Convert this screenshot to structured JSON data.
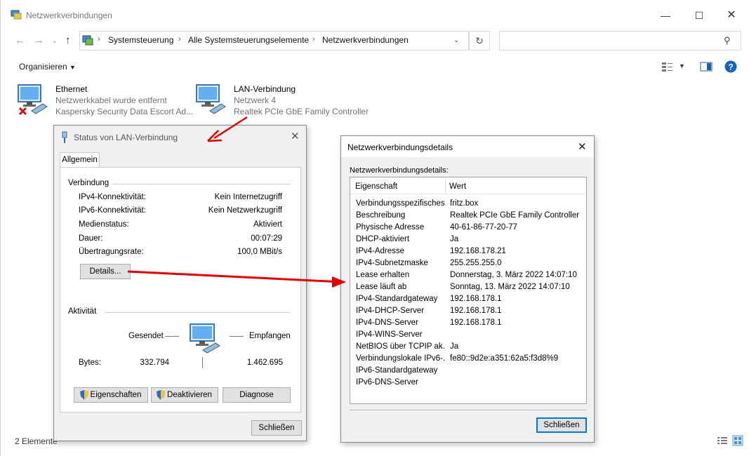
{
  "explorer": {
    "title": "Netzwerkverbindungen",
    "breadcrumb": [
      "Systemsteuerung",
      "Alle Systemsteuerungselemente",
      "Netzwerkverbindungen"
    ],
    "search_placeholder": "",
    "toolbar": {
      "organize_label": "Organisieren"
    },
    "items": [
      {
        "name": "Ethernet",
        "line1": "Netzwerkkabel wurde entfernt",
        "line2": "Kaspersky Security Data Escort Ad...",
        "status": "disconnected"
      },
      {
        "name": "LAN-Verbindung",
        "line1": "Netzwerk 4",
        "line2": "Realtek PCIe GbE Family Controller",
        "status": "connected"
      }
    ],
    "status_text": "2 Elemente"
  },
  "status_dialog": {
    "title": "Status von LAN-Verbindung",
    "tab": "Allgemein",
    "connection_group": "Verbindung",
    "rows": [
      {
        "label": "IPv4-Konnektivität:",
        "value": "Kein Internetzugriff"
      },
      {
        "label": "IPv6-Konnektivität:",
        "value": "Kein Netzwerkzugriff"
      },
      {
        "label": "Medienstatus:",
        "value": "Aktiviert"
      },
      {
        "label": "Dauer:",
        "value": "00:07:29"
      },
      {
        "label": "Übertragungsrate:",
        "value": "100,0 MBit/s"
      }
    ],
    "details_button": "Details...",
    "activity_group": "Aktivität",
    "sent_label": "Gesendet",
    "received_label": "Empfangen",
    "bytes_label": "Bytes:",
    "bytes_sent": "332.794",
    "bytes_received": "1.462.695",
    "properties_button": "Eigenschaften",
    "disable_button": "Deaktivieren",
    "diagnose_button": "Diagnose",
    "close_button": "Schließen"
  },
  "details_dialog": {
    "title": "Netzwerkverbindungsdetails",
    "label": "Netzwerkverbindungsdetails:",
    "col_property": "Eigenschaft",
    "col_value": "Wert",
    "rows": [
      {
        "k": "Verbindungsspezifisches...",
        "v": "fritz.box"
      },
      {
        "k": "Beschreibung",
        "v": "Realtek PCIe GbE Family Controller"
      },
      {
        "k": "Physische Adresse",
        "v": "40-61-86-77-20-77"
      },
      {
        "k": "DHCP-aktiviert",
        "v": "Ja"
      },
      {
        "k": "IPv4-Adresse",
        "v": "192.168.178.21"
      },
      {
        "k": "IPv4-Subnetzmaske",
        "v": "255.255.255.0"
      },
      {
        "k": "Lease erhalten",
        "v": "Donnerstag, 3. März 2022 14:07:10"
      },
      {
        "k": "Lease läuft ab",
        "v": "Sonntag, 13. März 2022 14:07:10"
      },
      {
        "k": "IPv4-Standardgateway",
        "v": "192.168.178.1"
      },
      {
        "k": "IPv4-DHCP-Server",
        "v": "192.168.178.1"
      },
      {
        "k": "IPv4-DNS-Server",
        "v": "192.168.178.1"
      },
      {
        "k": "IPv4-WINS-Server",
        "v": ""
      },
      {
        "k": "NetBIOS über TCPIP ak...",
        "v": "Ja"
      },
      {
        "k": "Verbindungslokale IPv6-...",
        "v": "fe80::9d2e:a351:62a5:f3d8%9"
      },
      {
        "k": "IPv6-Standardgateway",
        "v": ""
      },
      {
        "k": "IPv6-DNS-Server",
        "v": ""
      }
    ],
    "close_button": "Schließen"
  },
  "colors": {
    "accent": "#0078d7",
    "annotation_arrow": "#e00000",
    "help_icon": "#1565c0"
  }
}
